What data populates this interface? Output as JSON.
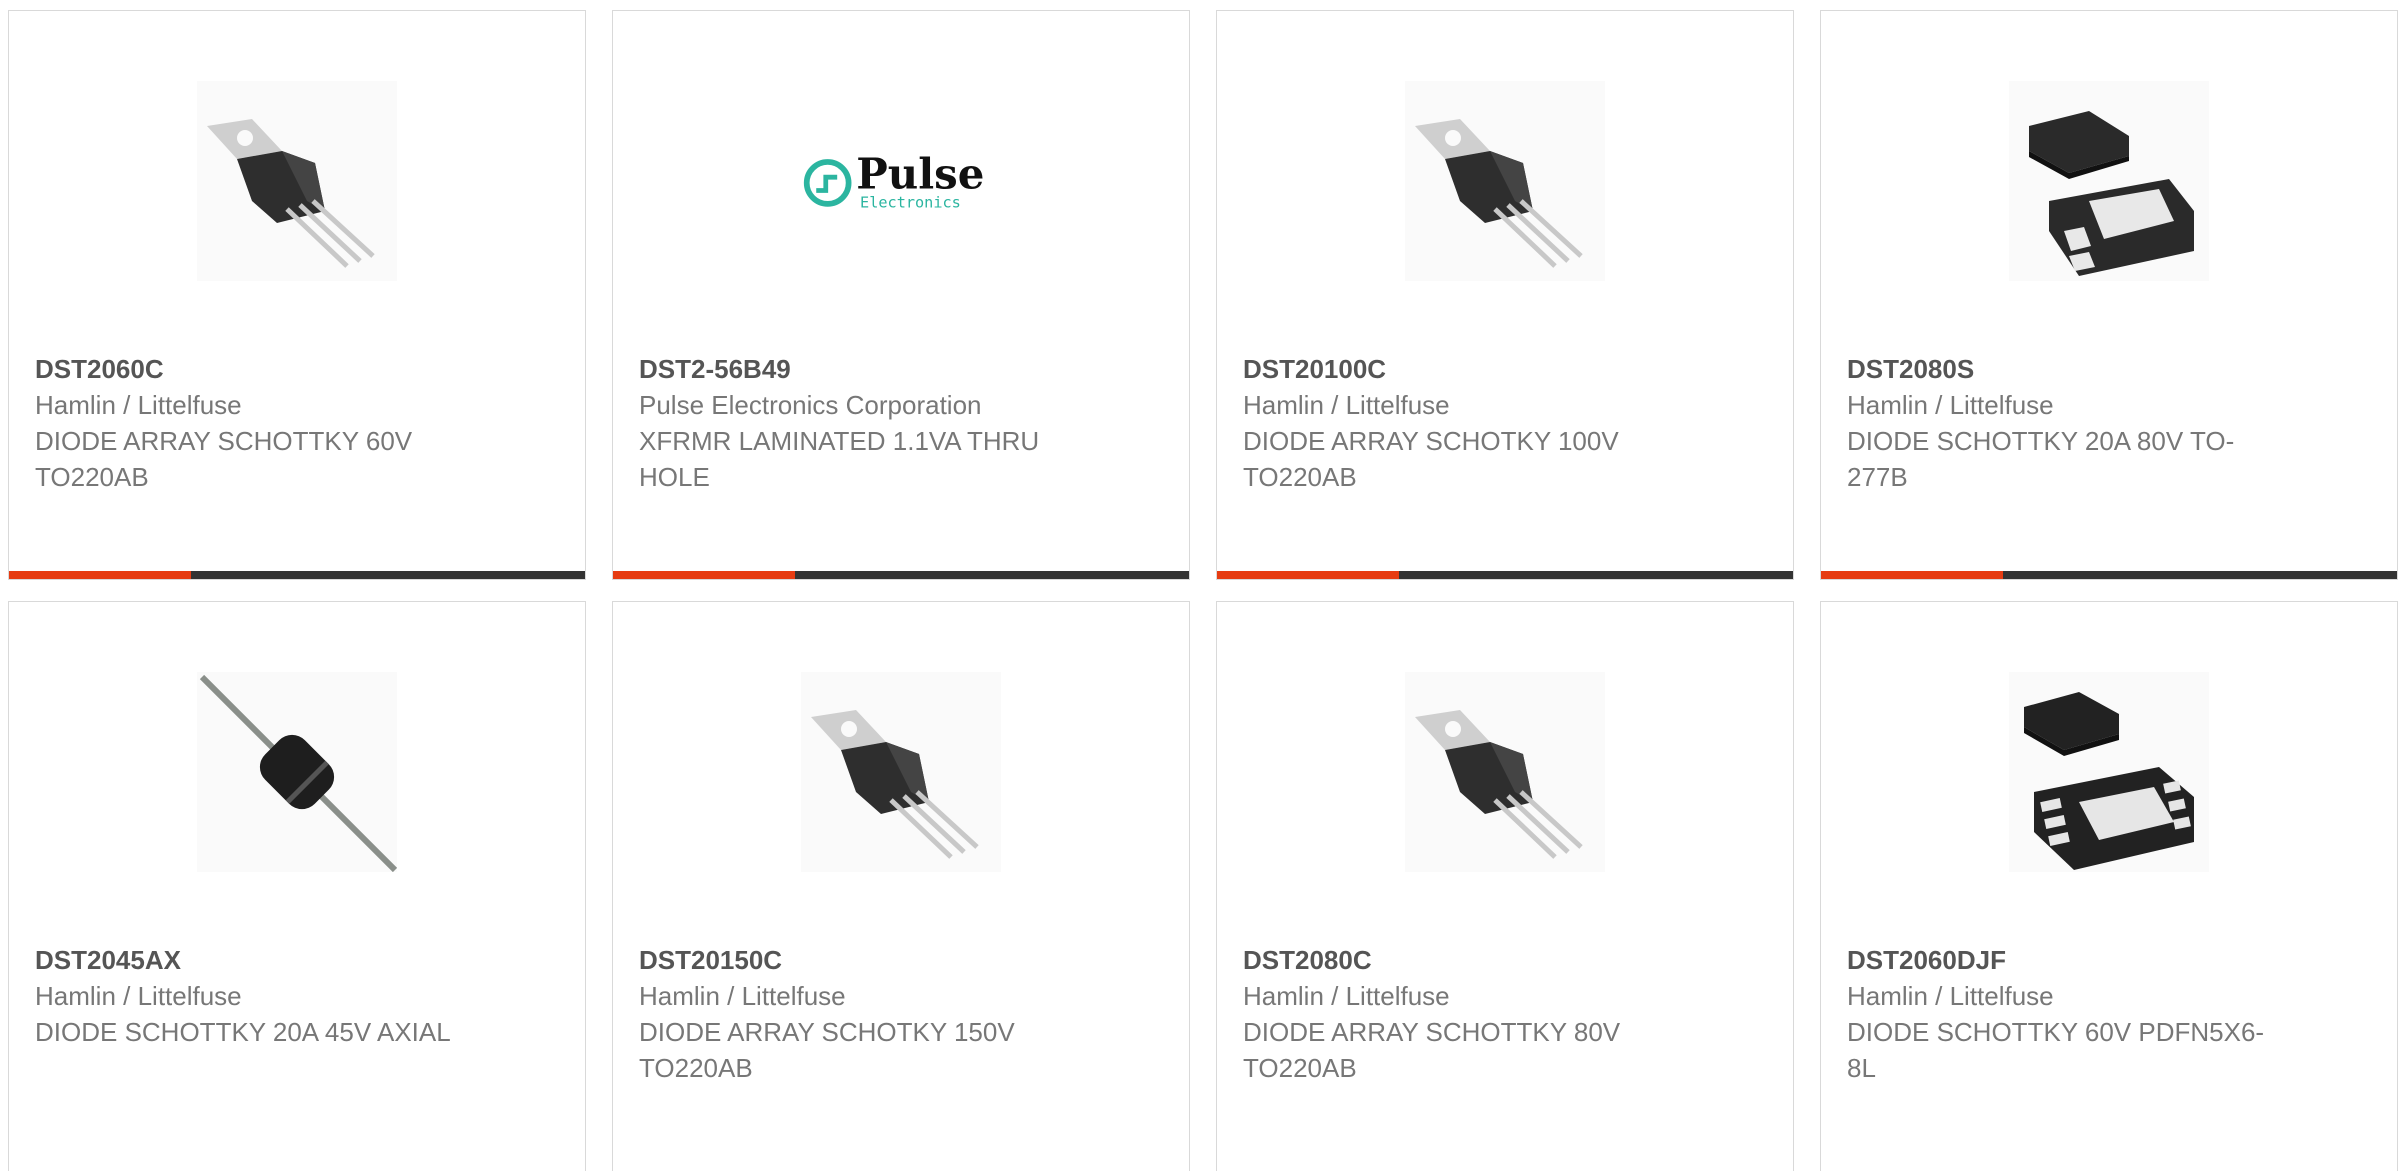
{
  "colors": {
    "accent": "#e63c12",
    "bar": "#333333",
    "border": "#d9d9d9",
    "pulse_teal": "#2bb5a0"
  },
  "products": [
    {
      "part": "DST2060C",
      "manufacturer": "Hamlin / Littelfuse",
      "description": "DIODE ARRAY SCHOTTKY 60V TO220AB",
      "image": "to220-package-icon"
    },
    {
      "part": "DST2-56B49",
      "manufacturer": "Pulse Electronics Corporation",
      "description": "XFRMR LAMINATED 1.1VA THRU HOLE",
      "image": "pulse-electronics-logo",
      "logo_word": "Pulse",
      "logo_sub": "Electronics"
    },
    {
      "part": "DST20100C",
      "manufacturer": "Hamlin / Littelfuse",
      "description": "DIODE ARRAY SCHOTKY 100V TO220AB",
      "image": "to220-package-icon"
    },
    {
      "part": "DST2080S",
      "manufacturer": "Hamlin / Littelfuse",
      "description": "DIODE SCHOTTKY 20A 80V TO-277B",
      "image": "to277b-package-icon"
    },
    {
      "part": "DST2045AX",
      "manufacturer": "Hamlin / Littelfuse",
      "description": "DIODE SCHOTTKY 20A 45V AXIAL",
      "image": "axial-diode-icon"
    },
    {
      "part": "DST20150C",
      "manufacturer": "Hamlin / Littelfuse",
      "description": "DIODE ARRAY SCHOTKY 150V TO220AB",
      "image": "to220-package-icon"
    },
    {
      "part": "DST2080C",
      "manufacturer": "Hamlin / Littelfuse",
      "description": "DIODE ARRAY SCHOTTKY 80V TO220AB",
      "image": "to220-package-icon"
    },
    {
      "part": "DST2060DJF",
      "manufacturer": "Hamlin / Littelfuse",
      "description": "DIODE SCHOTTKY 60V PDFN5X6-8L",
      "image": "pdfn-package-icon"
    }
  ]
}
